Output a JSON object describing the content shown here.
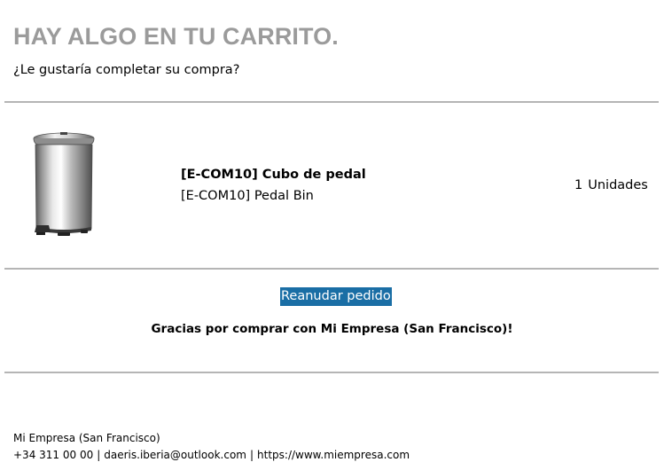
{
  "header": {
    "title": "HAY ALGO EN TU CARRITO.",
    "subtitle": "¿Le gustaría completar su compra?"
  },
  "cart": {
    "items": [
      {
        "name_bold": "[E-COM10] Cubo de pedal",
        "name": "[E-COM10] Pedal Bin",
        "quantity": "1",
        "unit": "Unidades",
        "image_icon": "pedal-bin-image"
      }
    ]
  },
  "actions": {
    "resume_label": "Reanudar pedido",
    "resume_color": "#1a6ea5"
  },
  "thanks": "Gracias por comprar con Mi Empresa (San Francisco)!",
  "footer": {
    "company": "Mi Empresa (San Francisco)",
    "phone": "+34 311 00 00",
    "separator": "|",
    "email": "daeris.iberia@outlook.com",
    "website": "https://www.miempresa.com"
  },
  "colors": {
    "heading": "#9b9b9b",
    "rule": "#b5b5b5"
  }
}
